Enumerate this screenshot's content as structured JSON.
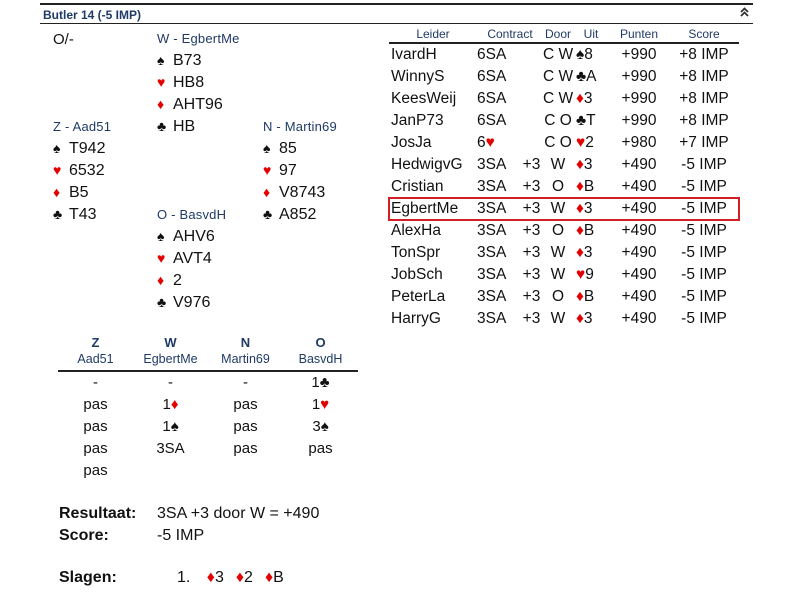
{
  "header": {
    "title": "Butler 14  (-5 IMP)",
    "collapse_icon": "double-chevron-up-icon"
  },
  "deal_info": "O/-",
  "hands": {
    "west": {
      "name": "W - EgbertMe",
      "spades": "B73",
      "hearts": "HB8",
      "diamonds": "AHT96",
      "clubs": "HB"
    },
    "south": {
      "name": "Z - Aad51",
      "spades": "T942",
      "hearts": "6532",
      "diamonds": "B5",
      "clubs": "T43"
    },
    "north": {
      "name": "N - Martin69",
      "spades": "85",
      "hearts": "97",
      "diamonds": "V8743",
      "clubs": "A852"
    },
    "east": {
      "name": "O - BasvdH",
      "spades": "AHV6",
      "hearts": "AVT4",
      "diamonds": "2",
      "clubs": "V976"
    }
  },
  "suits": {
    "spades": "♠",
    "hearts": "♥",
    "diamonds": "♦",
    "clubs": "♣"
  },
  "colors": {
    "red_suit": "#e30000",
    "header_text": "#1f3a66",
    "highlight": "#d21f26"
  },
  "bidding": {
    "headers": [
      {
        "seat": "Z",
        "name": "Aad51"
      },
      {
        "seat": "W",
        "name": "EgbertMe"
      },
      {
        "seat": "N",
        "name": "Martin69"
      },
      {
        "seat": "O",
        "name": "BasvdH"
      }
    ],
    "rows": [
      [
        "-",
        "-",
        "-",
        "1♣"
      ],
      [
        "pas",
        "1♦",
        "pas",
        "1♥"
      ],
      [
        "pas",
        "1♠",
        "pas",
        "3♠"
      ],
      [
        "pas",
        "3SA",
        "pas",
        "pas"
      ],
      [
        "pas",
        "",
        "",
        ""
      ]
    ]
  },
  "result": {
    "resultaat_label": "Resultaat:",
    "resultaat_value": "3SA +3 door W = +490",
    "score_label": "Score:",
    "score_value": "-5 IMP"
  },
  "tricks": {
    "label": "Slagen:",
    "number": "1.",
    "cards": [
      {
        "suit": "♦",
        "rank": "3"
      },
      {
        "suit": "♦",
        "rank": "2"
      },
      {
        "suit": "♦",
        "rank": "B"
      }
    ]
  },
  "results_table": {
    "headers": {
      "leider": "Leider",
      "contract": "Contract",
      "door": "Door",
      "uit": "Uit",
      "punten": "Punten",
      "score": "Score"
    },
    "rows": [
      {
        "leider": "IvardH",
        "contract": "6SA",
        "overtricks": "",
        "door": "C",
        "seat": "W",
        "lead_suit": "♠",
        "lead_rank": "8",
        "punten": "+990",
        "score": "+8 IMP"
      },
      {
        "leider": "WinnyS",
        "contract": "6SA",
        "overtricks": "",
        "door": "C",
        "seat": "W",
        "lead_suit": "♣",
        "lead_rank": "A",
        "punten": "+990",
        "score": "+8 IMP"
      },
      {
        "leider": "KeesWeij",
        "contract": "6SA",
        "overtricks": "",
        "door": "C",
        "seat": "W",
        "lead_suit": "♦",
        "lead_rank": "3",
        "punten": "+990",
        "score": "+8 IMP"
      },
      {
        "leider": "JanP73",
        "contract": "6SA",
        "overtricks": "",
        "door": "C",
        "seat": "O",
        "lead_suit": "♣",
        "lead_rank": "T",
        "punten": "+990",
        "score": "+8 IMP"
      },
      {
        "leider": "JosJa",
        "contract": "6♥",
        "overtricks": "",
        "door": "C",
        "seat": "O",
        "lead_suit": "♥",
        "lead_rank": "2",
        "punten": "+980",
        "score": "+7 IMP"
      },
      {
        "leider": "HedwigvG",
        "contract": "3SA",
        "overtricks": "+3",
        "door": "",
        "seat": "W",
        "lead_suit": "♦",
        "lead_rank": "3",
        "punten": "+490",
        "score": "-5 IMP"
      },
      {
        "leider": "Cristian",
        "contract": "3SA",
        "overtricks": "+3",
        "door": "",
        "seat": "O",
        "lead_suit": "♦",
        "lead_rank": "B",
        "punten": "+490",
        "score": "-5 IMP"
      },
      {
        "leider": "EgbertMe",
        "contract": "3SA",
        "overtricks": "+3",
        "door": "",
        "seat": "W",
        "lead_suit": "♦",
        "lead_rank": "3",
        "punten": "+490",
        "score": "-5 IMP",
        "highlight": true
      },
      {
        "leider": "AlexHa",
        "contract": "3SA",
        "overtricks": "+3",
        "door": "",
        "seat": "O",
        "lead_suit": "♦",
        "lead_rank": "B",
        "punten": "+490",
        "score": "-5 IMP"
      },
      {
        "leider": "TonSpr",
        "contract": "3SA",
        "overtricks": "+3",
        "door": "",
        "seat": "W",
        "lead_suit": "♦",
        "lead_rank": "3",
        "punten": "+490",
        "score": "-5 IMP"
      },
      {
        "leider": "JobSch",
        "contract": "3SA",
        "overtricks": "+3",
        "door": "",
        "seat": "W",
        "lead_suit": "♥",
        "lead_rank": "9",
        "punten": "+490",
        "score": "-5 IMP"
      },
      {
        "leider": "PeterLa",
        "contract": "3SA",
        "overtricks": "+3",
        "door": "",
        "seat": "O",
        "lead_suit": "♦",
        "lead_rank": "B",
        "punten": "+490",
        "score": "-5 IMP"
      },
      {
        "leider": "HarryG",
        "contract": "3SA",
        "overtricks": "+3",
        "door": "",
        "seat": "W",
        "lead_suit": "♦",
        "lead_rank": "3",
        "punten": "+490",
        "score": "-5 IMP"
      }
    ]
  }
}
